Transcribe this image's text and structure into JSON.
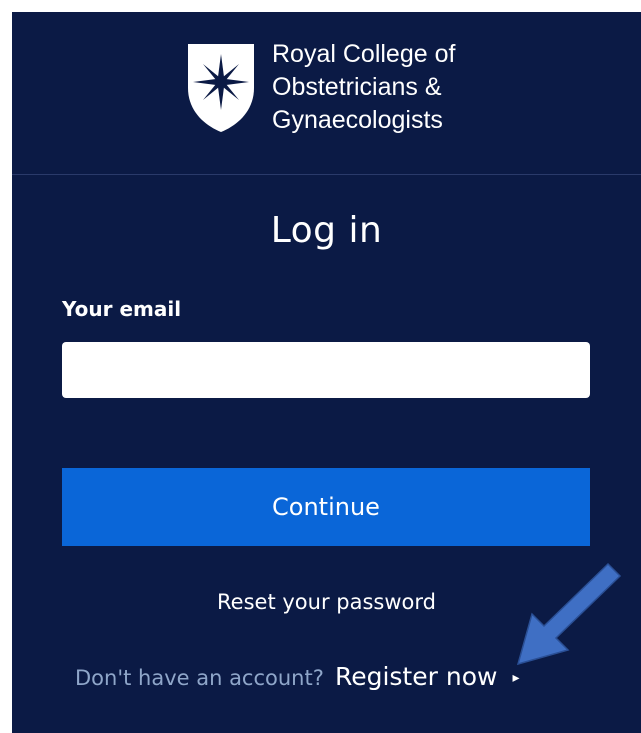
{
  "logo": {
    "line1": "Royal College of",
    "line2": "Obstetricians &",
    "line3": "Gynaecologists"
  },
  "login": {
    "title": "Log in",
    "email_label": "Your email",
    "email_value": "",
    "continue_label": "Continue",
    "reset_label": "Reset your password",
    "register_prompt": "Don't have an account?",
    "register_label": "Register now",
    "register_caret": "▸"
  },
  "colors": {
    "panel_bg": "#0b1a45",
    "button_bg": "#0a66d8",
    "prompt_text": "#8fa6c9",
    "annotation_arrow": "#3f6fc4"
  },
  "icons": {
    "logo": "rcog-shield-star-icon",
    "annotation": "arrow-down-left-icon",
    "register": "caret-right-icon"
  }
}
